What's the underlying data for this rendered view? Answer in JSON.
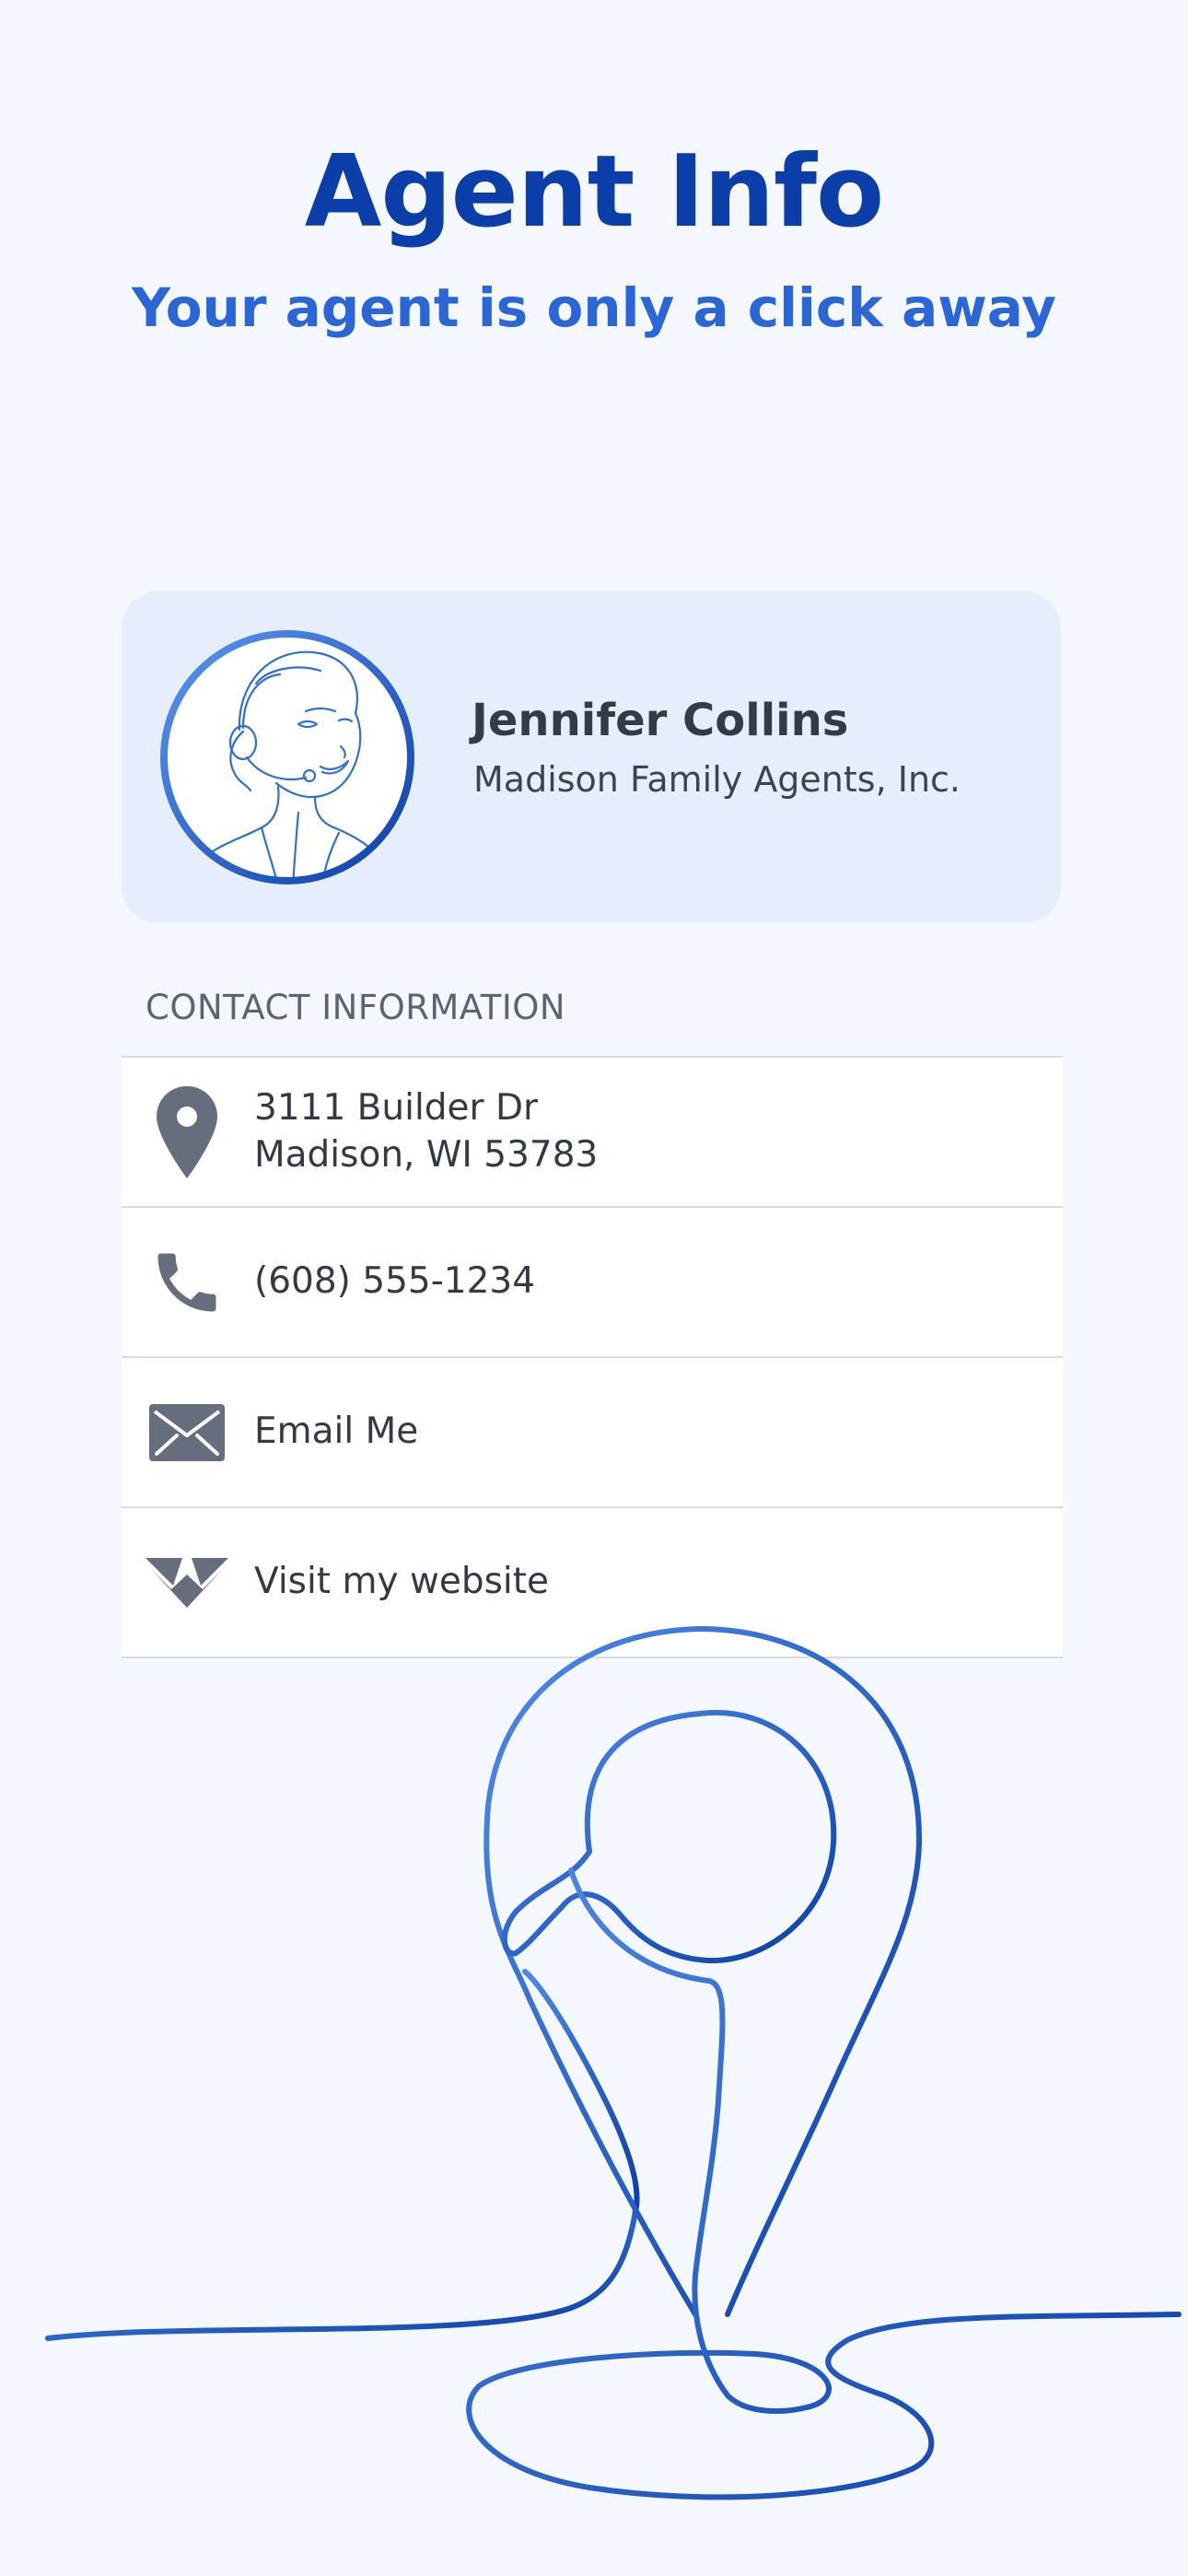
{
  "header": {
    "title": "Agent Info",
    "subtitle": "Your agent is only a click away"
  },
  "agent": {
    "name": "Jennifer Collins",
    "company": "Madison Family Agents, Inc.",
    "avatar_icon": "headset-agent-portrait-icon"
  },
  "contact": {
    "section_label": "CONTACT INFORMATION",
    "address": {
      "line1": "3111 Builder Dr",
      "line2": "Madison, WI 53783",
      "icon": "map-pin-icon"
    },
    "phone": {
      "label": "(608) 555-1234",
      "icon": "phone-icon"
    },
    "email": {
      "label": "Email Me",
      "icon": "envelope-icon"
    },
    "website": {
      "label": "Visit my website",
      "icon": "brand-logo-icon"
    }
  },
  "colors": {
    "background": "#f4f7fd",
    "title": "#0b3ea8",
    "subtitle": "#2a66d6",
    "card": "#e6edfd",
    "icon": "#666d7c",
    "doodle_light": "#4d8ae8",
    "doodle_dark": "#0b3ea8"
  }
}
